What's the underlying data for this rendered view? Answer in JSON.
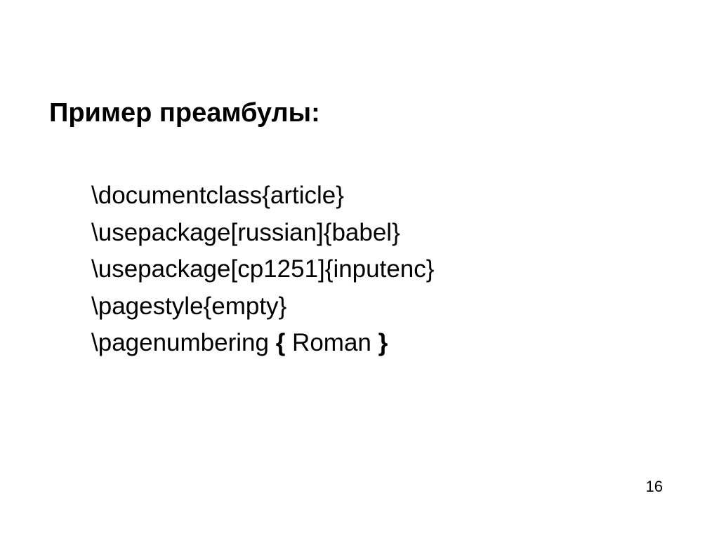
{
  "title": "Пример преамбулы:",
  "code_lines": {
    "line1": "\\documentclass{article}",
    "line2": "\\usepackage[russian]{babel}",
    "line3": "\\usepackage[cp1251]{inputenc}",
    "line4": "\\pagestyle{empty}",
    "line5_part1": "\\pagenumbering ",
    "line5_brace1": "{",
    "line5_part2": " Roman ",
    "line5_brace2": "}"
  },
  "page_number": "16"
}
